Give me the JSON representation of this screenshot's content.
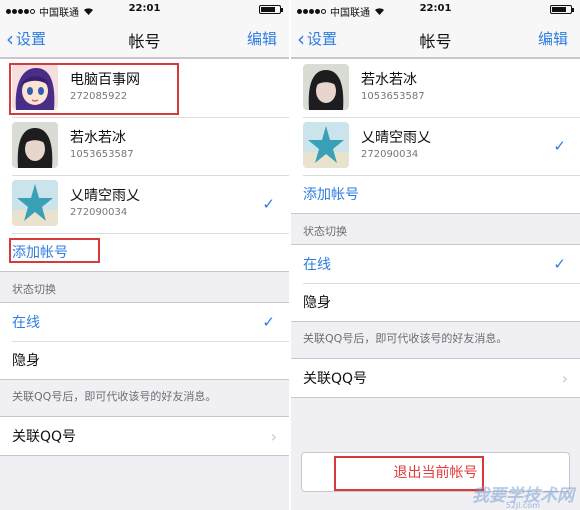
{
  "status_bar": {
    "carrier": "中国联通",
    "time": "22:01"
  },
  "navbar": {
    "back": "设置",
    "title": "帐号",
    "edit": "编辑"
  },
  "left": {
    "accounts": [
      {
        "name": "电脑百事网",
        "number": "272085922",
        "checked": false
      },
      {
        "name": "若水若冰",
        "number": "1053653587",
        "checked": false
      },
      {
        "name": "乂晴空雨乂",
        "number": "272090034",
        "checked": true
      }
    ],
    "add_account": "添加帐号",
    "status_header": "状态切换",
    "status_options": [
      {
        "label": "在线",
        "checked": true,
        "highlight": true
      },
      {
        "label": "隐身",
        "checked": false,
        "highlight": false
      }
    ],
    "footer_note": "关联QQ号后，即可代收该号的好友消息。",
    "link_qq": "关联QQ号"
  },
  "right": {
    "accounts": [
      {
        "name": "若水若冰",
        "number": "1053653587",
        "checked": false
      },
      {
        "name": "乂晴空雨乂",
        "number": "272090034",
        "checked": true
      }
    ],
    "add_account": "添加帐号",
    "status_header": "状态切换",
    "status_options": [
      {
        "label": "在线",
        "checked": true,
        "highlight": true
      },
      {
        "label": "隐身",
        "checked": false,
        "highlight": false
      }
    ],
    "footer_note": "关联QQ号后，即可代收该号的好友消息。",
    "link_qq": "关联QQ号",
    "logout": "退出当前帐号"
  },
  "icons": {
    "check": "✓",
    "chevron": "›",
    "back": "‹"
  },
  "colors": {
    "accent": "#2f7de1",
    "highlight_box": "#d63a3a",
    "logout_text": "#e23b3b"
  },
  "watermark": {
    "text": "我要学技术网",
    "url": "52jl.com"
  }
}
